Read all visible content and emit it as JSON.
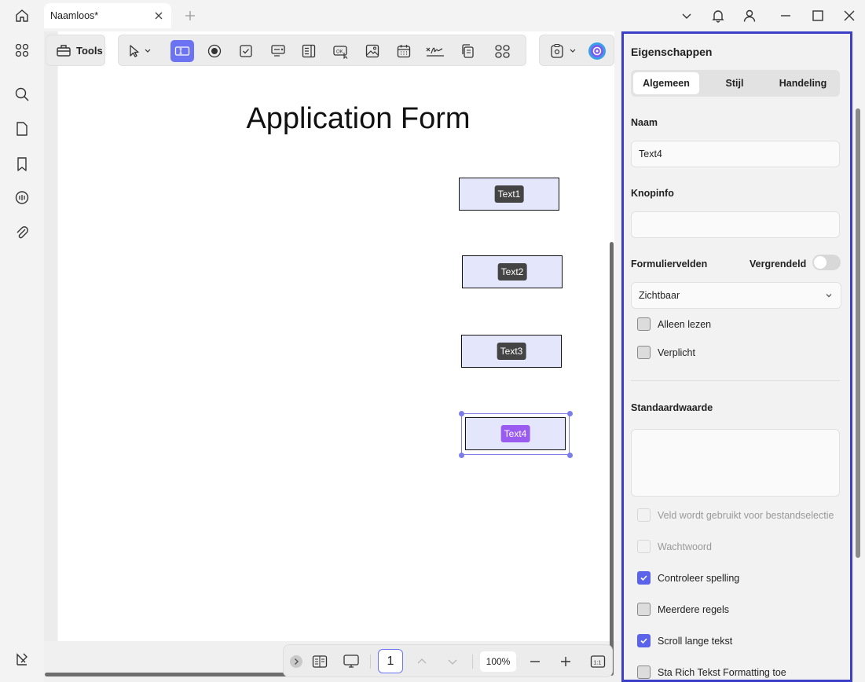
{
  "tab": {
    "title": "Naamloos*"
  },
  "toolbar": {
    "tools_label": "Tools"
  },
  "document": {
    "title": "Application Form",
    "fields": [
      {
        "label": "Text1"
      },
      {
        "label": "Text2"
      },
      {
        "label": "Text3"
      },
      {
        "label": "Text4"
      }
    ]
  },
  "pager": {
    "page": "1",
    "zoom": "100%"
  },
  "panel": {
    "title": "Eigenschappen",
    "tabs": [
      "Algemeen",
      "Stijl",
      "Handeling"
    ],
    "name_label": "Naam",
    "name_value": "Text4",
    "tooltip_label": "Knopinfo",
    "tooltip_value": "",
    "formfields_label": "Formuliervelden",
    "locked_label": "Vergrendeld",
    "visibility_value": "Zichtbaar",
    "readonly_label": "Alleen lezen",
    "required_label": "Verplicht",
    "default_label": "Standaardwaarde",
    "file_select_label": "Veld wordt gebruikt voor bestandselectie",
    "password_label": "Wachtwoord",
    "spellcheck_label": "Controleer spelling",
    "multiline_label": "Meerdere regels",
    "scroll_label": "Scroll lange tekst",
    "richtext_label": "Sta Rich Tekst Formatting toe"
  },
  "colors": {
    "accent": "#6b73f2",
    "panel_border": "#3b3fc8",
    "selected_tag": "#9a5cf0"
  }
}
